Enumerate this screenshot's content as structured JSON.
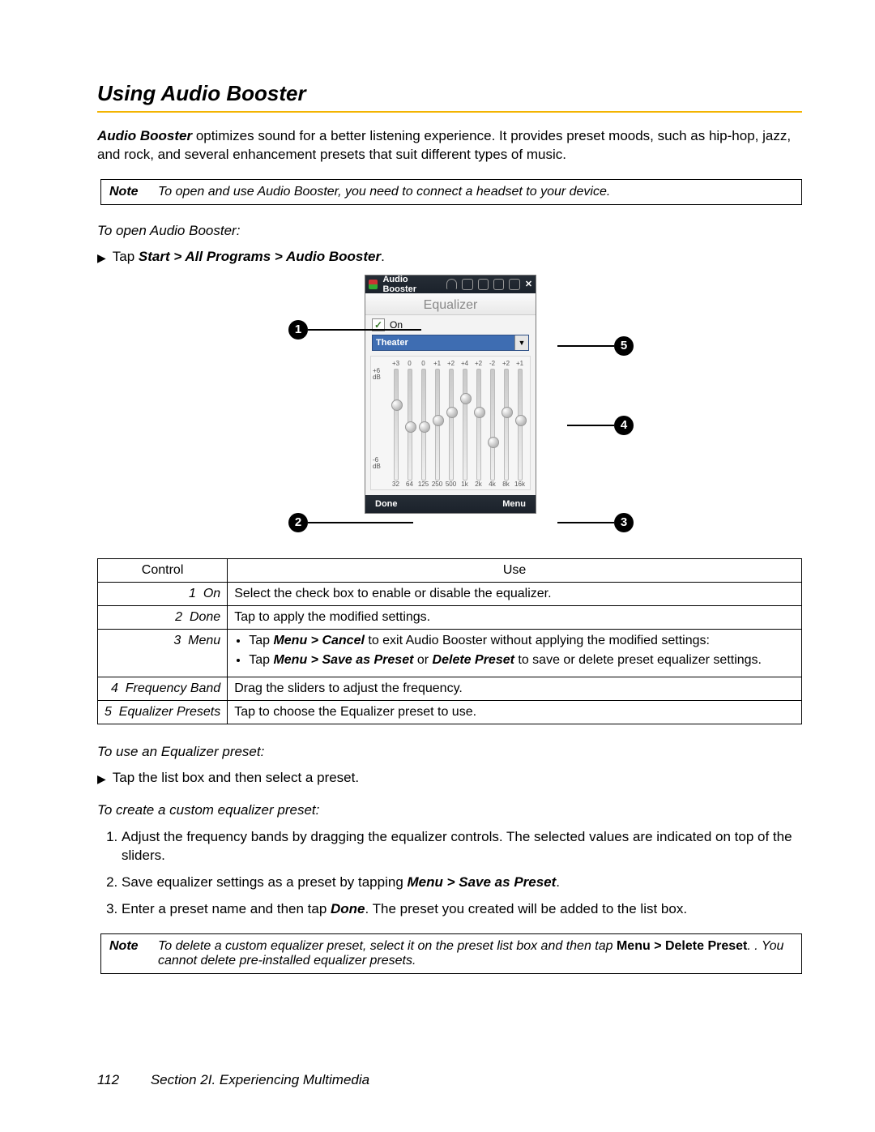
{
  "title": "Using Audio Booster",
  "intro_lead": "Audio Booster",
  "intro_rest": " optimizes sound for a better listening experience. It provides preset moods, such as hip-hop, jazz, and rock, and several enhancement presets that suit different types of music.",
  "note1_label": "Note",
  "note1_text": "To open and use Audio Booster, you need to connect a headset to your device.",
  "open_heading": "To open Audio Booster:",
  "open_step_lead": "Tap ",
  "open_step_path": "Start > All Programs > Audio Booster",
  "open_step_tail": ".",
  "screenshot": {
    "title": "Audio Booster",
    "panel": "Equalizer",
    "on_label": "On",
    "preset": "Theater",
    "done": "Done",
    "menu": "Menu",
    "top_scale": [
      "+3",
      "0",
      "0",
      "+1",
      "+2",
      "+4",
      "+2",
      "-2",
      "+2",
      "+1"
    ],
    "side_top": "+6\ndB",
    "side_bot": "-6\ndB",
    "freqs": [
      "32",
      "64",
      "125",
      "250",
      "500",
      "1k",
      "2k",
      "4k",
      "8k",
      "16k"
    ],
    "knob_pct": [
      28,
      48,
      48,
      42,
      35,
      22,
      35,
      62,
      35,
      42
    ],
    "callouts": {
      "1": "1",
      "2": "2",
      "3": "3",
      "4": "4",
      "5": "5"
    }
  },
  "table": {
    "h1": "Control",
    "h2": "Use",
    "rows": [
      {
        "n": "1",
        "name": "On",
        "use_plain": "Select the check box to enable or disable the equalizer."
      },
      {
        "n": "2",
        "name": "Done",
        "use_plain": "Tap to apply the modified settings."
      },
      {
        "n": "3",
        "name": "Menu",
        "use_bullets": [
          {
            "pre": "Tap ",
            "b": "Menu > Cancel",
            "post": " to exit Audio Booster without applying the modified settings:"
          },
          {
            "pre": "Tap ",
            "b": "Menu > Save as Preset",
            "mid": " or ",
            "b2": "Delete Preset",
            "post": " to save or delete preset equalizer settings."
          }
        ]
      },
      {
        "n": "4",
        "name": "Frequency Band",
        "use_plain": "Drag the sliders to adjust the frequency."
      },
      {
        "n": "5",
        "name": "Equalizer Presets",
        "use_plain": "Tap to choose the Equalizer preset to use."
      }
    ]
  },
  "use_preset_heading": "To use an Equalizer preset:",
  "use_preset_step": "Tap the list box and then select a preset.",
  "create_heading": "To create a custom equalizer preset:",
  "create_steps": [
    "Adjust the frequency bands by dragging the equalizer controls. The selected values are indicated on top of the sliders.",
    {
      "pre": "Save equalizer settings as a preset by tapping ",
      "b": "Menu > Save as Preset",
      "post": "."
    },
    {
      "pre": "Enter a preset name and then tap ",
      "b": "Done",
      "post": ". The preset you created will be added to the list box."
    }
  ],
  "note2_label": "Note",
  "note2_pre": "To delete a custom equalizer preset, select it on the preset list box and then tap ",
  "note2_b": "Menu > Delete Preset",
  "note2_post": ". You cannot delete pre-installed equalizer presets.",
  "footer_page": "112",
  "footer_text": "Section 2I. Experiencing Multimedia"
}
